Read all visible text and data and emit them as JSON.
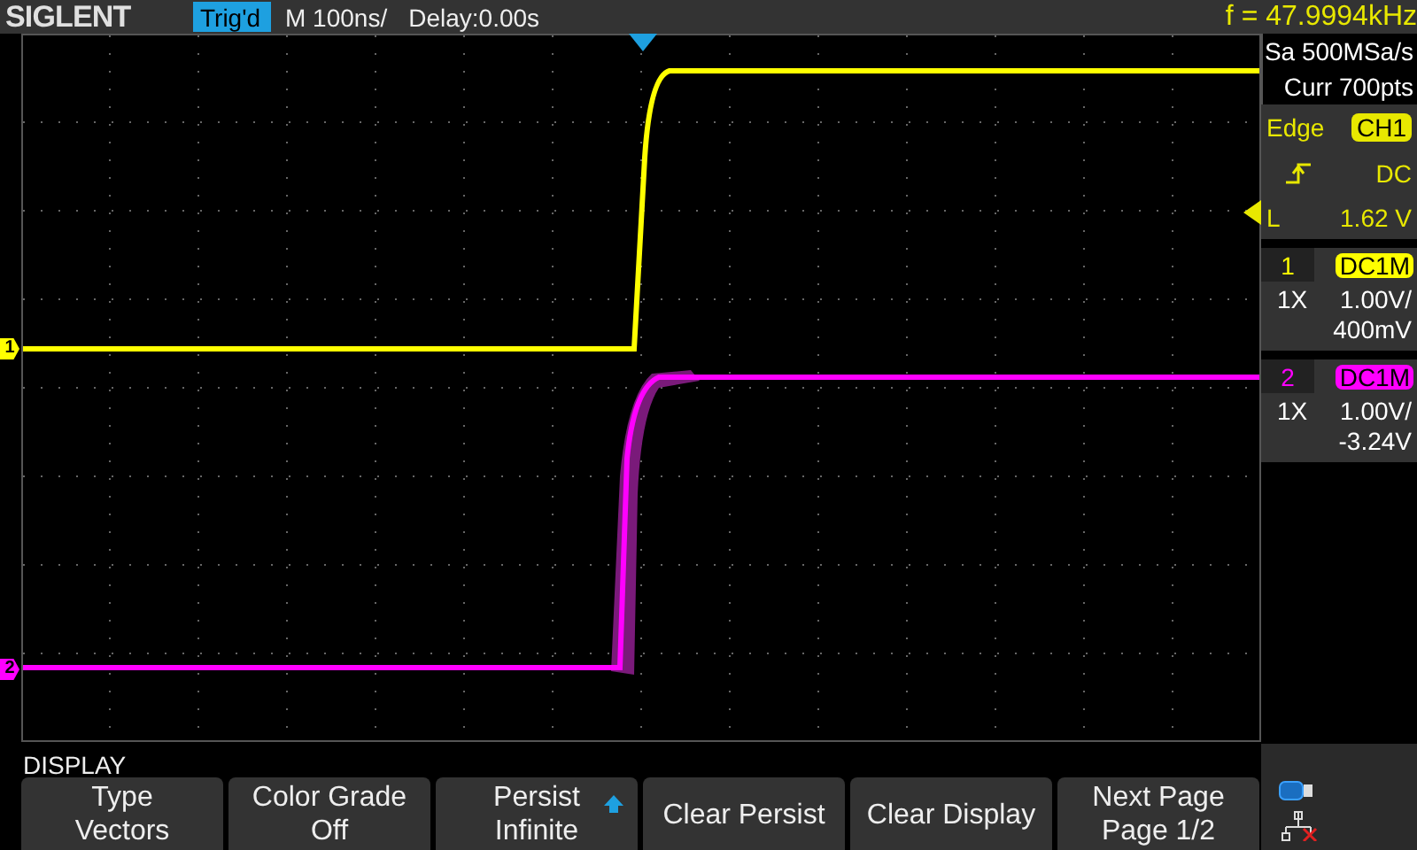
{
  "top_bar": {
    "logo": "SIGLENT",
    "trigger_status": "Trig'd",
    "timebase": "M 100ns/",
    "delay": "Delay:0.00s",
    "frequency": "f = 47.9994kHz"
  },
  "channel_markers": [
    {
      "label": "1",
      "color": "#ffff00"
    },
    {
      "label": "2",
      "color": "#ff00ff"
    }
  ],
  "acquisition": {
    "sample_rate": "Sa 500MSa/s",
    "memory": "Curr 700pts"
  },
  "trigger": {
    "type": "Edge",
    "source": "CH1",
    "coupling": "DC",
    "level_label": "L",
    "level_reading": "1.62 V"
  },
  "channels": [
    {
      "number": "1",
      "coupling": "DC1M",
      "probe": "1X",
      "scale": "1.00V/",
      "offset": "400mV",
      "color": "#ffff00"
    },
    {
      "number": "2",
      "coupling": "DC1M",
      "probe": "1X",
      "scale": "1.00V/",
      "offset": "-3.24V",
      "color": "#ff00ff"
    }
  ],
  "menu": {
    "title": "DISPLAY",
    "buttons": [
      {
        "label": "Type",
        "value": "Vectors"
      },
      {
        "label": "Color Grade",
        "value": "Off"
      },
      {
        "label": "Persist",
        "value": "Infinite",
        "kind": "arrow"
      },
      {
        "label": "Clear Persist"
      },
      {
        "label": "Clear Display"
      },
      {
        "label": "Next Page",
        "value": "Page 1/2"
      }
    ]
  }
}
